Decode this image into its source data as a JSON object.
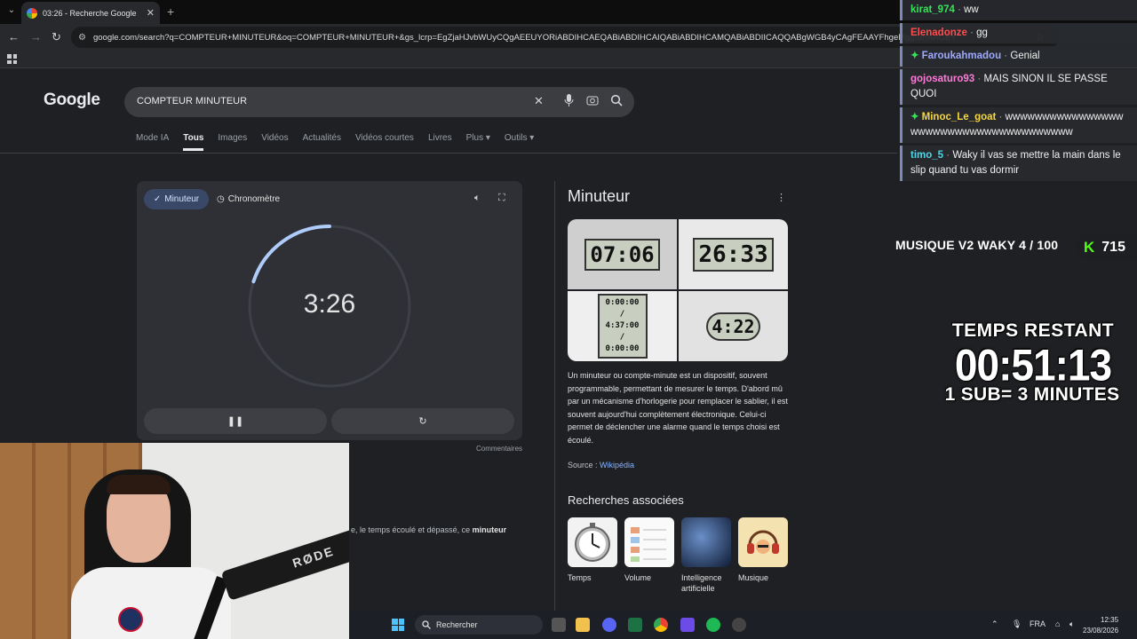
{
  "browser": {
    "tab_title": "03:26 - Recherche Google",
    "url": "google.com/search?q=COMPTEUR+MINUTEUR&oq=COMPTEUR+MINUTEUR+&gs_lcrp=EgZjaHJvbWUyCQgAEEUYORiABDIHCAEQABiABDIHCAIQABiABDIHCAMQABiABDIICAQQABgWGB4yCAgFEAAYFhgeMggIBhAAGBY"
  },
  "search": {
    "logo": "Google",
    "query": "COMPTEUR MINUTEUR",
    "tabs": [
      "Mode IA",
      "Tous",
      "Images",
      "Vidéos",
      "Actualités",
      "Vidéos courtes",
      "Livres",
      "Plus ▾",
      "Outils ▾"
    ],
    "active_tab": "Tous"
  },
  "timer": {
    "mode_minuteur": "Minuteur",
    "mode_chrono": "Chronomètre",
    "time": "3:26",
    "progress": 0.2,
    "pause_icon": "pause-icon",
    "reset_icon": "reset-icon",
    "comments": "Commentaires"
  },
  "knowledge_panel": {
    "title": "Minuteur",
    "images": [
      "07:06",
      "26:33",
      "0:00:00 / 4:37:00 / 0:00:00",
      "4:22"
    ],
    "description": "Un minuteur ou compte-minute est un dispositif, souvent programmable, permettant de mesurer le temps. D'abord mû par un mécanisme d'horlogerie pour remplacer le sablier, il est souvent aujourd'hui complètement électronique. Celui-ci permet de déclencher une alarme quand le temps choisi est écoulé.",
    "source_label": "Source : ",
    "source_link": "Wikipédia",
    "related_title": "Recherches associées",
    "related": [
      {
        "label": "Temps"
      },
      {
        "label": "Volume"
      },
      {
        "label": "Intelligence artificielle"
      },
      {
        "label": "Musique"
      }
    ],
    "snippet_prefix": "e, le temps écoulé et dépassé, ce ",
    "snippet_bold": "minuteur"
  },
  "chat": [
    {
      "user": "kirat_974",
      "color": "#39e05a",
      "text": "ww",
      "sparkle": false
    },
    {
      "user": "Elenadonze",
      "color": "#ff4d4d",
      "text": "gg",
      "sparkle": false
    },
    {
      "user": "Faroukahmadou",
      "color": "#9fa8ff",
      "text": "Genial",
      "sparkle": true
    },
    {
      "user": "gojosaturo93",
      "color": "#ff7ad9",
      "text": "MAIS SINON IL SE PASSE QUOI",
      "sparkle": false
    },
    {
      "user": "Minoc_Le_goat",
      "color": "#f5d742",
      "text": "wwwwwwwwwwwwwwwwwwwwwwwwwwwwwwwwwwwwww",
      "sparkle": true
    },
    {
      "user": "timo_5",
      "color": "#4fd6e8",
      "text": "Waky il vas se mettre la main dans le slip quand tu vas dormir",
      "sparkle": false
    }
  ],
  "stream": {
    "music": "MUSIQUE V2 WAKY 4 / 100",
    "kick_letter": "K",
    "kick_count": "715",
    "temps_label": "TEMPS RESTANT",
    "temps_value": "00:51:13",
    "temps_sub": "1 SUB= 3 MINUTES"
  },
  "taskbar": {
    "search_label": "Rechercher",
    "lang": "FRA",
    "time": "12:35",
    "date": "23/08/2026"
  },
  "colors": {
    "accent": "#8ab4f8",
    "ring": "#aecbfa",
    "kick_green": "#53fc18"
  }
}
